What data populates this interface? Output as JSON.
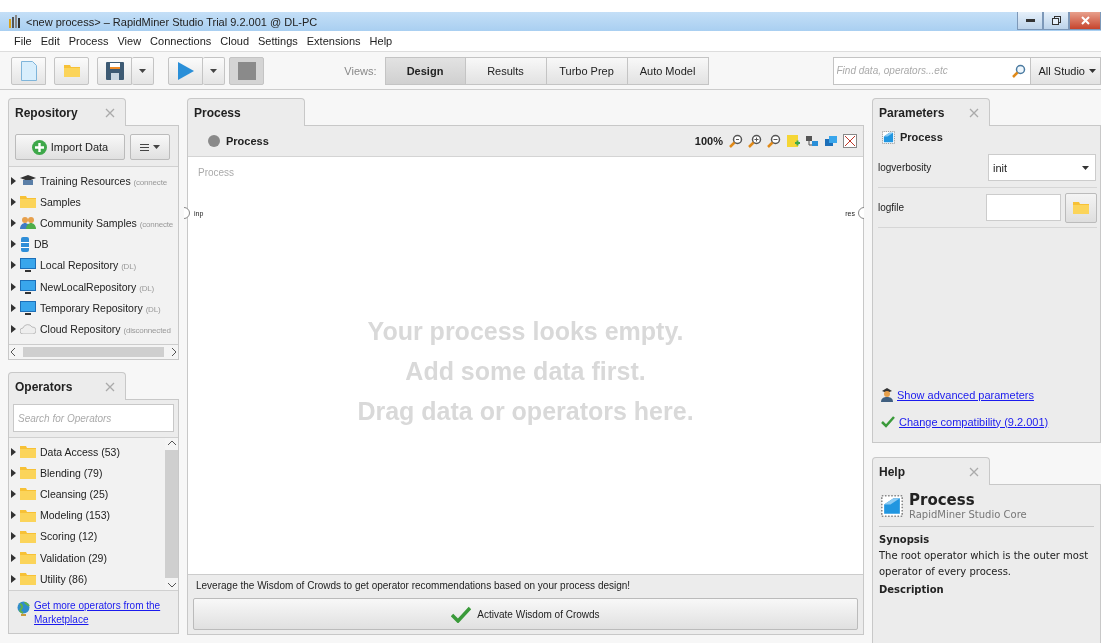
{
  "window": {
    "title": "<new process> – RapidMiner Studio Trial 9.2.001 @ DL-PC"
  },
  "menu": [
    "File",
    "Edit",
    "Process",
    "View",
    "Connections",
    "Cloud",
    "Settings",
    "Extensions",
    "Help"
  ],
  "toolbar": {
    "views_label": "Views:",
    "views": [
      {
        "label": "Design",
        "selected": true
      },
      {
        "label": "Results",
        "selected": false
      },
      {
        "label": "Turbo Prep",
        "selected": false
      },
      {
        "label": "Auto Model",
        "selected": false
      }
    ],
    "search": {
      "placeholder": "Find data, operators...etc"
    },
    "scope": "All Studio"
  },
  "repository": {
    "title": "Repository",
    "import_button": "Import Data",
    "items": [
      {
        "kind": "training",
        "name": "Training Resources",
        "note": "(connecte"
      },
      {
        "kind": "folder",
        "name": "Samples"
      },
      {
        "kind": "people",
        "name": "Community Samples",
        "note": "(connecte"
      },
      {
        "kind": "database",
        "name": "DB"
      },
      {
        "kind": "monitor",
        "name": "Local Repository",
        "note": "(DL)"
      },
      {
        "kind": "monitor",
        "name": "NewLocalRepository",
        "note": "(DL)"
      },
      {
        "kind": "monitor",
        "name": "Temporary Repository",
        "note": "(DL)"
      },
      {
        "kind": "cloud",
        "name": "Cloud Repository",
        "note": "(disconnected"
      }
    ]
  },
  "operators": {
    "title": "Operators",
    "search": {
      "placeholder": "Search for Operators"
    },
    "items": [
      {
        "name": "Data Access (53)"
      },
      {
        "name": "Blending (79)"
      },
      {
        "name": "Cleansing (25)"
      },
      {
        "name": "Modeling (153)"
      },
      {
        "name": "Scoring (12)"
      },
      {
        "name": "Validation (29)"
      },
      {
        "name": "Utility (86)"
      }
    ],
    "marketplace_link": "Get more operators from the Marketplace"
  },
  "process": {
    "tab": "Process",
    "header": "Process",
    "zoom": "100%",
    "canvas_label": "Process",
    "input_port": "inp",
    "output_port": "res",
    "empty_message": [
      "Your process looks empty.",
      "Add some data first.",
      "Drag data or operators here."
    ],
    "wisdom_text": "Leverage the Wisdom of Crowds to get operator recommendations based on your process design!",
    "wisdom_button": "Activate Wisdom of Crowds"
  },
  "parameters": {
    "title": "Parameters",
    "operator": "Process",
    "rows": [
      {
        "kind": "select",
        "name": "logverbosity",
        "value": "init"
      },
      {
        "kind": "file",
        "name": "logfile"
      }
    ],
    "links": [
      {
        "kind": "advanced",
        "label": "Show advanced parameters"
      },
      {
        "kind": "compat",
        "label": "Change compatibility (9.2.001)"
      }
    ]
  },
  "help": {
    "title": "Help",
    "operator": "Process",
    "source": "RapidMiner Studio Core",
    "synopsis_heading": "Synopsis",
    "synopsis": "The root operator which is the outer most operator of every process.",
    "description_heading": "Description"
  }
}
